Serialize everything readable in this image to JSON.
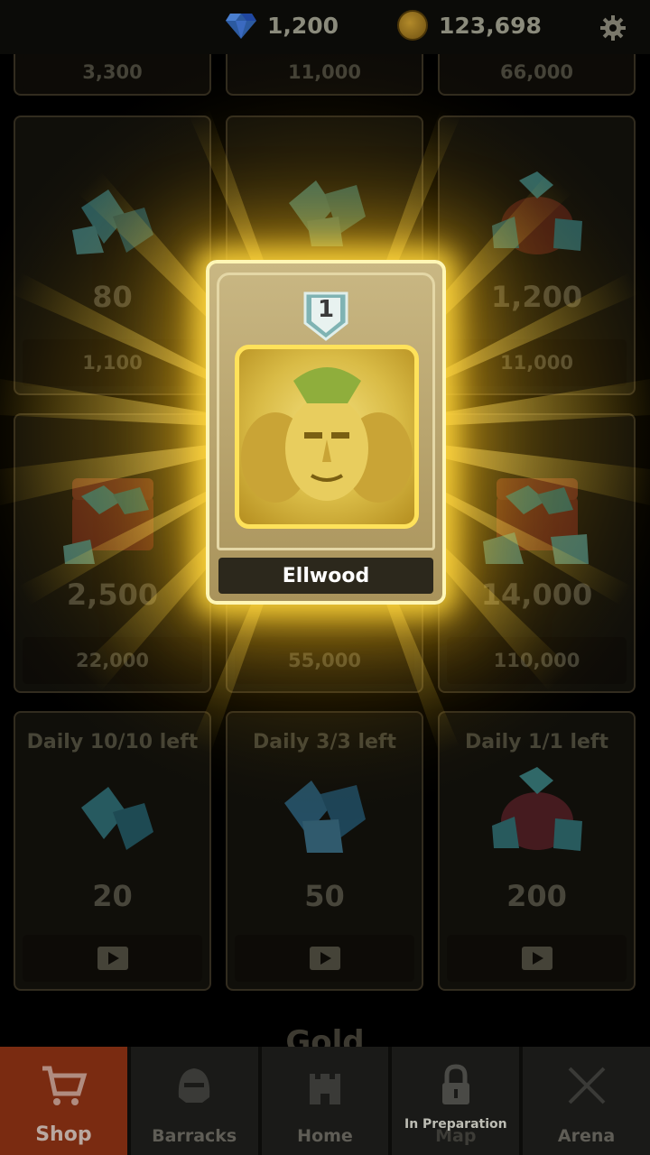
{
  "topbar": {
    "gems": "1,200",
    "gold": "123,698",
    "icons": [
      "gem-icon",
      "coin-icon",
      "gear-icon"
    ]
  },
  "shop": {
    "top_row_prices": [
      "3,300",
      "11,000",
      "66,000"
    ],
    "row1": [
      {
        "amount": "80",
        "price": "1,100"
      },
      {
        "amount": "",
        "price": ""
      },
      {
        "amount": "1,200",
        "price": "11,000"
      }
    ],
    "row2": [
      {
        "amount": "2,500",
        "price": "22,000"
      },
      {
        "amount": "",
        "price": "55,000"
      },
      {
        "amount": "14,000",
        "price": "110,000"
      }
    ],
    "daily": [
      {
        "label": "Daily 10/10 left",
        "amount": "20"
      },
      {
        "label": "Daily 3/3 left",
        "amount": "50"
      },
      {
        "label": "Daily 1/1 left",
        "amount": "200"
      }
    ],
    "section_title": "Gold"
  },
  "reward_card": {
    "level": "1",
    "name": "Ellwood"
  },
  "nav": {
    "tabs": [
      {
        "label": "Shop",
        "active": true
      },
      {
        "label": "Barracks"
      },
      {
        "label": "Home"
      },
      {
        "label": "Map",
        "overlay": "In Preparation"
      },
      {
        "label": "Arena"
      }
    ]
  },
  "colors": {
    "glow": "#ffd23c",
    "active_tab": "#7a2b11",
    "card_border": "#fff6b5"
  }
}
